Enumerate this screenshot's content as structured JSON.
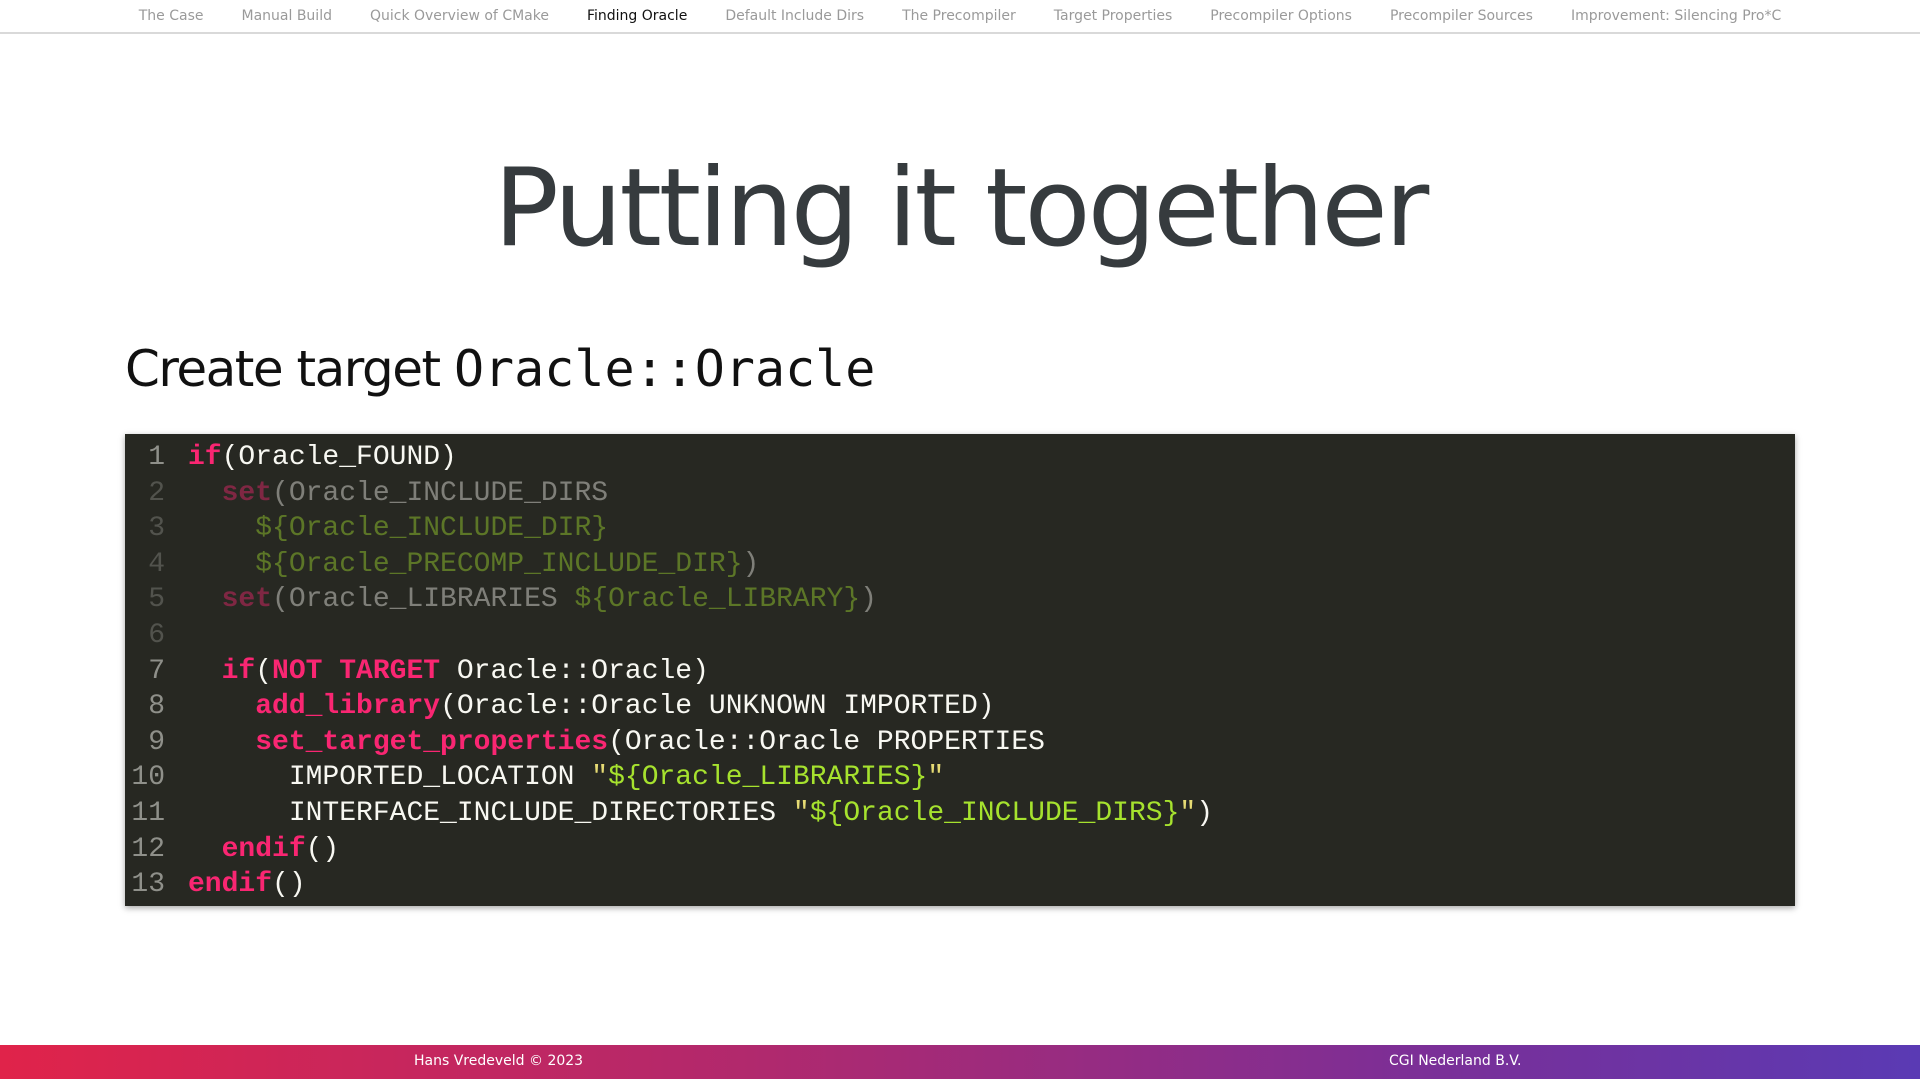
{
  "nav": {
    "items": [
      {
        "label": "The Case",
        "active": false
      },
      {
        "label": "Manual Build",
        "active": false
      },
      {
        "label": "Quick Overview of CMake",
        "active": false
      },
      {
        "label": "Finding Oracle",
        "active": true
      },
      {
        "label": "Default Include Dirs",
        "active": false
      },
      {
        "label": "The Precompiler",
        "active": false
      },
      {
        "label": "Target Properties",
        "active": false
      },
      {
        "label": "Precompiler Options",
        "active": false
      },
      {
        "label": "Precompiler Sources",
        "active": false
      },
      {
        "label": "Improvement: Silencing Pro*C",
        "active": false
      }
    ]
  },
  "slide": {
    "title": "Putting it together",
    "subtitle_text": "Create target ",
    "subtitle_code": "Oracle::Oracle"
  },
  "code": {
    "line_numbers": [
      "1",
      "2",
      "3",
      "4",
      "5",
      "6",
      "7",
      "8",
      "9",
      "10",
      "11",
      "12",
      "13"
    ],
    "lines": {
      "l1": {
        "kw": "if",
        "rest": "(Oracle_FOUND)"
      },
      "l2": {
        "indent": "  ",
        "kw": "set",
        "rest": "(Oracle_INCLUDE_DIRS"
      },
      "l3": {
        "indent": "    ",
        "var": "${Oracle_INCLUDE_DIR}"
      },
      "l4": {
        "indent": "    ",
        "var": "${Oracle_PRECOMP_INCLUDE_DIR}",
        "rest": ")"
      },
      "l5": {
        "indent": "  ",
        "kw": "set",
        "rest": "(Oracle_LIBRARIES ",
        "var": "${Oracle_LIBRARY}",
        "close": ")"
      },
      "l6": {
        "text": ""
      },
      "l7": {
        "indent": "  ",
        "kw": "if",
        "open": "(",
        "kw2": "NOT TARGET",
        "rest": " Oracle::Oracle)"
      },
      "l8": {
        "indent": "    ",
        "kw": "add_library",
        "rest": "(Oracle::Oracle UNKNOWN IMPORTED)"
      },
      "l9": {
        "indent": "    ",
        "kw": "set_target_properties",
        "rest": "(Oracle::Oracle PROPERTIES"
      },
      "l10": {
        "indent": "      ",
        "rest": "IMPORTED_LOCATION ",
        "q1": "\"",
        "var": "${Oracle_LIBRARIES}",
        "q2": "\""
      },
      "l11": {
        "indent": "      ",
        "rest": "INTERFACE_INCLUDE_DIRECTORIES ",
        "q1": "\"",
        "var": "${Oracle_INCLUDE_DIRS}",
        "q2": "\"",
        "close": ")"
      },
      "l12": {
        "indent": "  ",
        "kw": "endif",
        "rest": "()"
      },
      "l13": {
        "kw": "endif",
        "rest": "()"
      }
    }
  },
  "footer": {
    "author": "Hans Vredeveld © 2023",
    "company": "CGI Nederland B.V."
  },
  "colors": {
    "code_bg": "#272822",
    "keyword": "#f92672",
    "variable": "#a6e22e",
    "string_quote": "#e6db74",
    "footer_gradient_start": "#e0234a",
    "footer_gradient_end": "#5a3ab4"
  }
}
